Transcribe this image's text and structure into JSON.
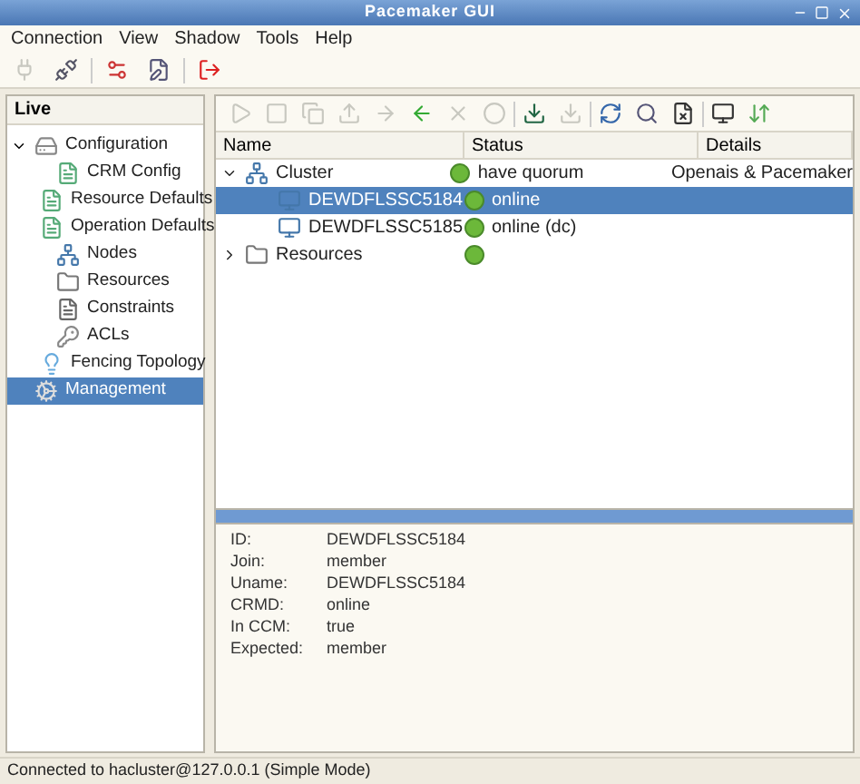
{
  "window": {
    "title": "Pacemaker GUI"
  },
  "menu": [
    "Connection",
    "View",
    "Shadow",
    "Tools",
    "Help"
  ],
  "sidebar": {
    "header": "Live",
    "items": [
      {
        "label": "Configuration",
        "kind": "drive",
        "expanded": true,
        "selected": false,
        "children": [
          {
            "label": "CRM Config",
            "kind": "config",
            "selected": false
          },
          {
            "label": "Resource Defaults",
            "kind": "config",
            "selected": false
          },
          {
            "label": "Operation Defaults",
            "kind": "config",
            "selected": false
          },
          {
            "label": "Nodes",
            "kind": "nodes",
            "selected": false
          },
          {
            "label": "Resources",
            "kind": "folder",
            "selected": false
          },
          {
            "label": "Constraints",
            "kind": "doc",
            "selected": false
          },
          {
            "label": "ACLs",
            "kind": "keys",
            "selected": false
          },
          {
            "label": "Fencing Topology",
            "kind": "bulb",
            "selected": false
          }
        ]
      },
      {
        "label": "Management",
        "kind": "gears",
        "selected": true
      }
    ]
  },
  "table": {
    "columns": [
      "Name",
      "Status",
      "Details"
    ],
    "rows": [
      {
        "name": "Cluster",
        "kind": "cluster",
        "expanded": true,
        "selected": false,
        "status": "have quorum",
        "details": "Openais & Pacemaker",
        "children": [
          {
            "name": "DEWDFLSSC5184",
            "kind": "node",
            "selected": true,
            "status": "online"
          },
          {
            "name": "DEWDFLSSC5185",
            "kind": "node",
            "selected": false,
            "status": "online (dc)"
          }
        ]
      },
      {
        "name": "Resources",
        "kind": "folder",
        "expanded": false,
        "selected": false,
        "status": ""
      }
    ]
  },
  "details": [
    {
      "label": "ID:",
      "value": "DEWDFLSSC5184"
    },
    {
      "label": "Join:",
      "value": "member"
    },
    {
      "label": "Uname:",
      "value": "DEWDFLSSC5184"
    },
    {
      "label": "CRMD:",
      "value": "online"
    },
    {
      "label": "In CCM:",
      "value": "true"
    },
    {
      "label": "Expected:",
      "value": "member"
    }
  ],
  "status_bar": "Connected to hacluster@127.0.0.1 (Simple Mode)"
}
